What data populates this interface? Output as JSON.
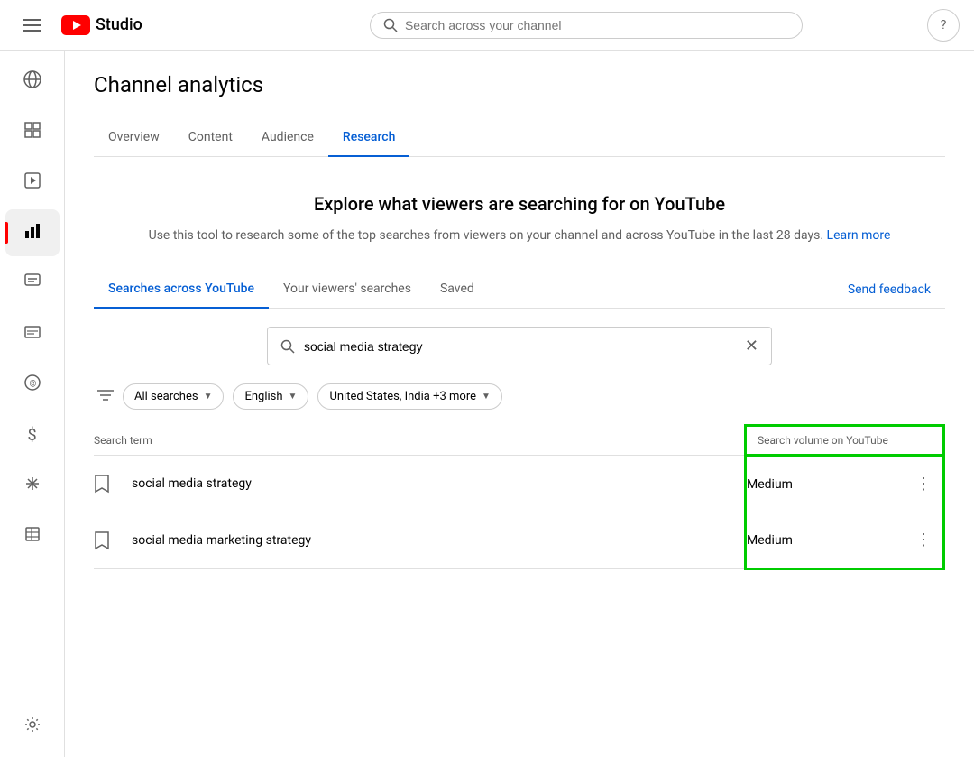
{
  "header": {
    "menu_label": "Menu",
    "logo_text": "Studio",
    "search_placeholder": "Search across your channel",
    "help_label": "Help"
  },
  "sidebar": {
    "items": [
      {
        "id": "explore",
        "label": "",
        "icon": "🌐"
      },
      {
        "id": "dashboard",
        "label": "",
        "icon": "⊞"
      },
      {
        "id": "content",
        "label": "",
        "icon": "▶"
      },
      {
        "id": "analytics",
        "label": "",
        "icon": "📊",
        "active": true
      },
      {
        "id": "comments",
        "label": "",
        "icon": "☰"
      },
      {
        "id": "subtitles",
        "label": "",
        "icon": "≡"
      },
      {
        "id": "copyright",
        "label": "",
        "icon": "©"
      },
      {
        "id": "monetization",
        "label": "",
        "icon": "$"
      },
      {
        "id": "customise",
        "label": "",
        "icon": "✦"
      },
      {
        "id": "library",
        "label": "",
        "icon": "▤"
      }
    ],
    "settings_icon": "⚙"
  },
  "page": {
    "title": "Channel analytics"
  },
  "tabs": [
    {
      "id": "overview",
      "label": "Overview",
      "active": false
    },
    {
      "id": "content",
      "label": "Content",
      "active": false
    },
    {
      "id": "audience",
      "label": "Audience",
      "active": false
    },
    {
      "id": "research",
      "label": "Research",
      "active": true
    }
  ],
  "research": {
    "explore_title": "Explore what viewers are searching for on YouTube",
    "explore_desc": "Use this tool to research some of the top searches from viewers on your channel and across YouTube in the last 28 days.",
    "learn_more_text": "Learn more",
    "sub_tabs": [
      {
        "id": "searches_youtube",
        "label": "Searches across YouTube",
        "active": true
      },
      {
        "id": "viewers_searches",
        "label": "Your viewers' searches",
        "active": false
      },
      {
        "id": "saved",
        "label": "Saved",
        "active": false
      }
    ],
    "send_feedback_label": "Send feedback",
    "search_value": "social media strategy",
    "filters": {
      "filter_icon": "filter",
      "chips": [
        {
          "id": "search_type",
          "label": "All searches"
        },
        {
          "id": "language",
          "label": "English"
        },
        {
          "id": "location",
          "label": "United States, India +3 more"
        }
      ]
    },
    "table": {
      "col_term": "Search term",
      "col_volume": "Search volume on YouTube",
      "rows": [
        {
          "id": "row1",
          "term": "social media strategy",
          "volume": "Medium"
        },
        {
          "id": "row2",
          "term": "social media marketing strategy",
          "volume": "Medium"
        }
      ]
    }
  }
}
